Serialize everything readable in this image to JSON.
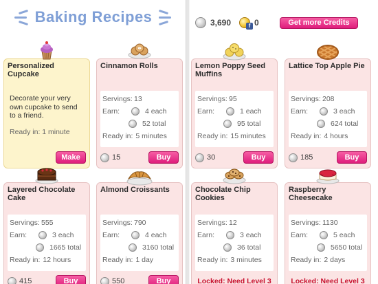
{
  "header": {
    "title": "Baking Recipes",
    "coins": "3,690",
    "credits": "0",
    "get_credits_label": "Get more Credits"
  },
  "labels": {
    "servings": "Servings:",
    "earn": "Earn:",
    "ready_in": "Ready in:"
  },
  "featured": {
    "name": "Personalized Cupcake",
    "description": "Decorate your very own cupcake to send to a friend.",
    "ready": "Ready in: 1 minute",
    "button": "Make",
    "icon": "cupcake-icon"
  },
  "recipes": [
    {
      "name": "Cinnamon Rolls",
      "servings": "13",
      "each": "4 each",
      "total": "52 total",
      "ready": "5 minutes",
      "price": "15",
      "button": "Buy",
      "locked": "",
      "icon": "cinnamon-rolls-icon"
    },
    {
      "name": "Lemon Poppy Seed Muffins",
      "servings": "95",
      "each": "1 each",
      "total": "95 total",
      "ready": "15 minutes",
      "price": "30",
      "button": "Buy",
      "locked": "",
      "icon": "muffins-icon"
    },
    {
      "name": "Lattice Top Apple Pie",
      "servings": "208",
      "each": "3 each",
      "total": "624 total",
      "ready": "4 hours",
      "price": "185",
      "button": "Buy",
      "locked": "",
      "icon": "apple-pie-icon"
    },
    {
      "name": "Layered Chocolate Cake",
      "servings": "555",
      "each": "3 each",
      "total": "1665 total",
      "ready": "12 hours",
      "price": "415",
      "button": "Buy",
      "locked": "",
      "icon": "chocolate-cake-icon"
    },
    {
      "name": "Almond Croissants",
      "servings": "790",
      "each": "4 each",
      "total": "3160 total",
      "ready": "1 day",
      "price": "550",
      "button": "Buy",
      "locked": "",
      "icon": "croissants-icon"
    },
    {
      "name": "Chocolate Chip Cookies",
      "servings": "12",
      "each": "3 each",
      "total": "36 total",
      "ready": "3 minutes",
      "price": "",
      "button": "",
      "locked": "Locked: Need Level 3",
      "icon": "cookies-icon"
    },
    {
      "name": "Raspberry Cheesecake",
      "servings": "1130",
      "each": "5 each",
      "total": "5650 total",
      "ready": "2 days",
      "price": "",
      "button": "",
      "locked": "Locked: Need Level 3",
      "icon": "cheesecake-icon"
    }
  ],
  "colors": {
    "title_blue": "#7f9fd6",
    "card_pink": "#fbe4e4",
    "featured_yellow": "#fdf4cc",
    "button_pink": "#e8318a",
    "locked_red": "#c8102e"
  }
}
